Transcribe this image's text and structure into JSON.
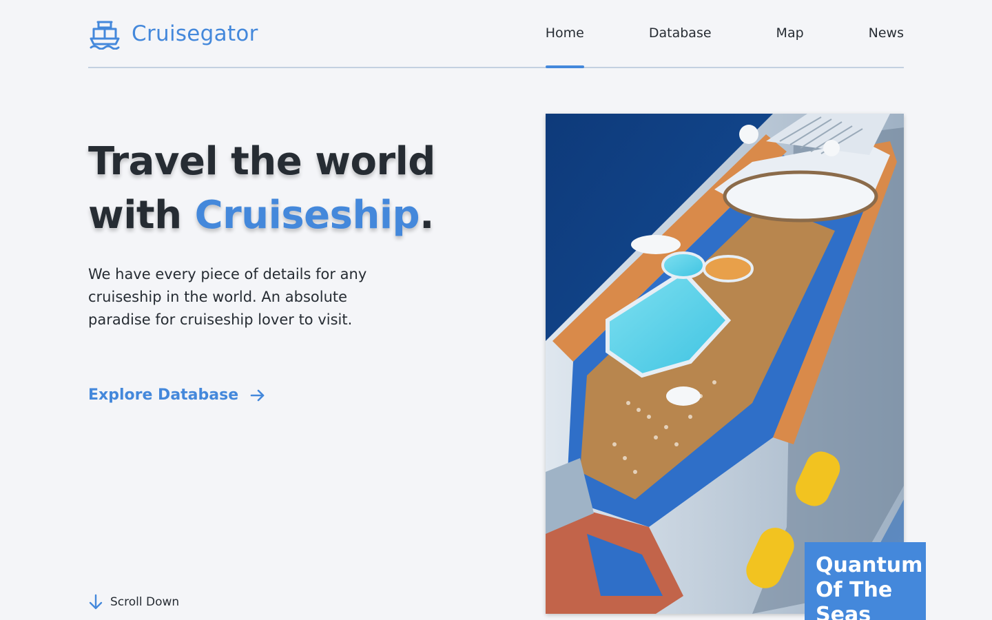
{
  "brand": {
    "name": "Cruisegator",
    "icon": "ship-icon",
    "color": "#4488db"
  },
  "nav": {
    "items": [
      {
        "label": "Home",
        "active": true
      },
      {
        "label": "Database",
        "active": false
      },
      {
        "label": "Map",
        "active": false
      },
      {
        "label": "News",
        "active": false
      }
    ]
  },
  "hero": {
    "title_line1": "Travel the world",
    "title_line2_prefix": "with ",
    "title_accent": "Cruiseship",
    "title_suffix": ".",
    "description": "We have every piece of details for any cruiseship in the world. An absolute paradise for cruiseship lover to visit.",
    "cta_label": "Explore Database",
    "cta_icon": "arrow-right-icon",
    "scroll_label": "Scroll Down",
    "scroll_icon": "arrow-down-icon"
  },
  "feature": {
    "image_subject": "aerial view of cruise ship deck with pools at sea",
    "caption": "Quantum Of The Seas"
  },
  "colors": {
    "accent": "#4488db",
    "text": "#262c33",
    "background": "#f4f5f8"
  }
}
